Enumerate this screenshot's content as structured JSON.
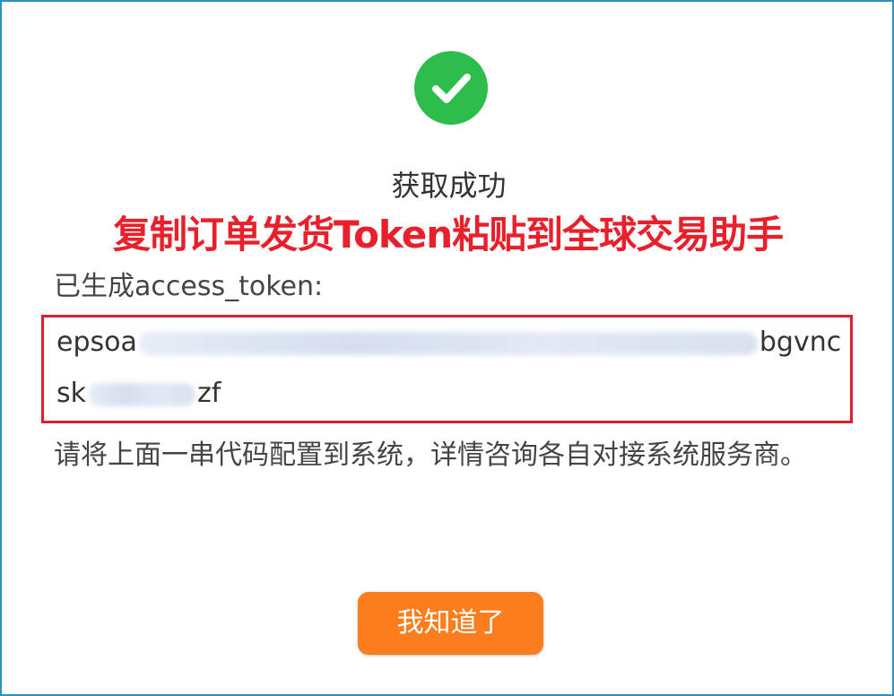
{
  "dialog": {
    "title": "获取成功",
    "annotation": "复制订单发货Token粘贴到全球交易助手",
    "label": "已生成access_token:",
    "token": {
      "line1_start": "epsoa",
      "line1_end": "bgvnc",
      "line2_start": "sk",
      "line2_end": "zf"
    },
    "description": "请将上面一串代码配置到系统，详情咨询各自对接系统服务商。",
    "ok_button_label": "我知道了"
  },
  "colors": {
    "success_green": "#2cbd4a",
    "annotation_red": "#e8202b",
    "highlight_border": "#e11f2b",
    "button_orange": "#fb7d1d",
    "frame_border": "#2c94c0"
  },
  "icons": {
    "success": "check-circle-icon"
  }
}
